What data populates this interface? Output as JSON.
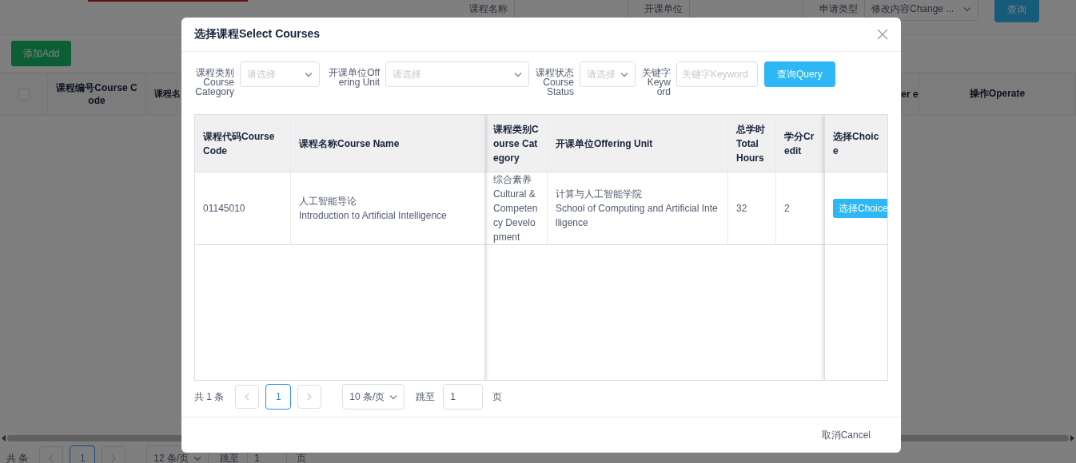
{
  "background": {
    "filters": [
      {
        "label": "课程名称",
        "kind": "input"
      },
      {
        "label": "开课单位",
        "kind": "input"
      },
      {
        "label": "申请类型",
        "kind": "select",
        "value": "修改内容Change ..."
      }
    ],
    "search_button": "查询",
    "select_all_checked": false,
    "add_button": "添加Add",
    "table_columns": [
      "课程编号Course Code",
      "课程名",
      "er e",
      "操作Operate"
    ],
    "pagination": {
      "total": "共 条",
      "pages": [
        {
          "label": "1",
          "selected": true
        }
      ],
      "page_size": "12 条/页",
      "jump_label": "跳至",
      "jump_value": "1",
      "jump_unit": "页"
    }
  },
  "modal": {
    "title": "选择课程Select Courses",
    "filters": [
      {
        "label": "课程类别Course Category",
        "kind": "select",
        "placeholder": "请选择"
      },
      {
        "label": "开课单位Offering Unit",
        "kind": "select",
        "placeholder": "请选择"
      },
      {
        "label": "课程状态Course Status",
        "kind": "select",
        "placeholder": "请选择"
      },
      {
        "label": "关键字Keyword",
        "kind": "input",
        "placeholder": "关键字Keyword"
      }
    ],
    "query_button": "查询Query",
    "table": {
      "columns": [
        "课程代码Course Code",
        "课程名称Course Name",
        "课程类别Course Category",
        "开课单位Offering Unit",
        "总学时Total Hours",
        "学分Credit",
        "选择Choice"
      ],
      "rows": [
        {
          "cells": [
            "01145010",
            "人工智能导论\nIntroduction to Artificial Intelligence",
            "综合素养\nCultural & Competency Development",
            "计算与人工智能学院\nSchool of Computing and Artificial Intelligence",
            "32",
            "2"
          ],
          "action": "选择Choice"
        }
      ]
    },
    "pagination": {
      "total": "共 1 条",
      "pages": [
        {
          "label": "1",
          "selected": true
        }
      ],
      "page_size": "10 条/页",
      "jump_label": "跳至",
      "jump_value": "1",
      "jump_unit": "页"
    },
    "cancel_button": "取消Cancel"
  }
}
